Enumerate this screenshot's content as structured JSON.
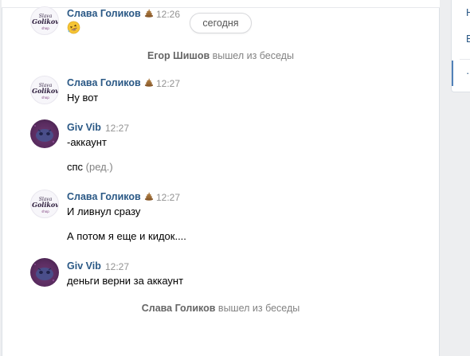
{
  "date_divider": "сегодня",
  "right_panel": {
    "items": [
      "Н",
      "В",
      "·"
    ]
  },
  "messages": [
    {
      "author": "Слава Голиков",
      "time": "12:26",
      "text": ""
    },
    {
      "author": "Слава Голиков",
      "time": "12:27",
      "text": "Ну вот"
    },
    {
      "author": "Giv Vib",
      "time": "12:27",
      "text": "-аккаунт",
      "text2": "спс",
      "edited": "(ред.)"
    },
    {
      "author": "Слава Голиков",
      "time": "12:27",
      "text": "И ливнул сразу",
      "text2": "А потом я еще и кидок...."
    },
    {
      "author": "Giv Vib",
      "time": "12:27",
      "text": "деньги верни за аккаунт"
    }
  ],
  "service": [
    {
      "name": "Егор Шишов",
      "action": "вышел из беседы"
    },
    {
      "name": "Слава Голиков",
      "action": "вышел из беседы"
    }
  ],
  "colors": {
    "author": "#2a5885",
    "time": "#939393",
    "service": "#828282",
    "accent": "#5181b8"
  },
  "icons": {
    "emoji_1": "rofl-emoji-icon",
    "status": "poop-emoji-icon"
  }
}
